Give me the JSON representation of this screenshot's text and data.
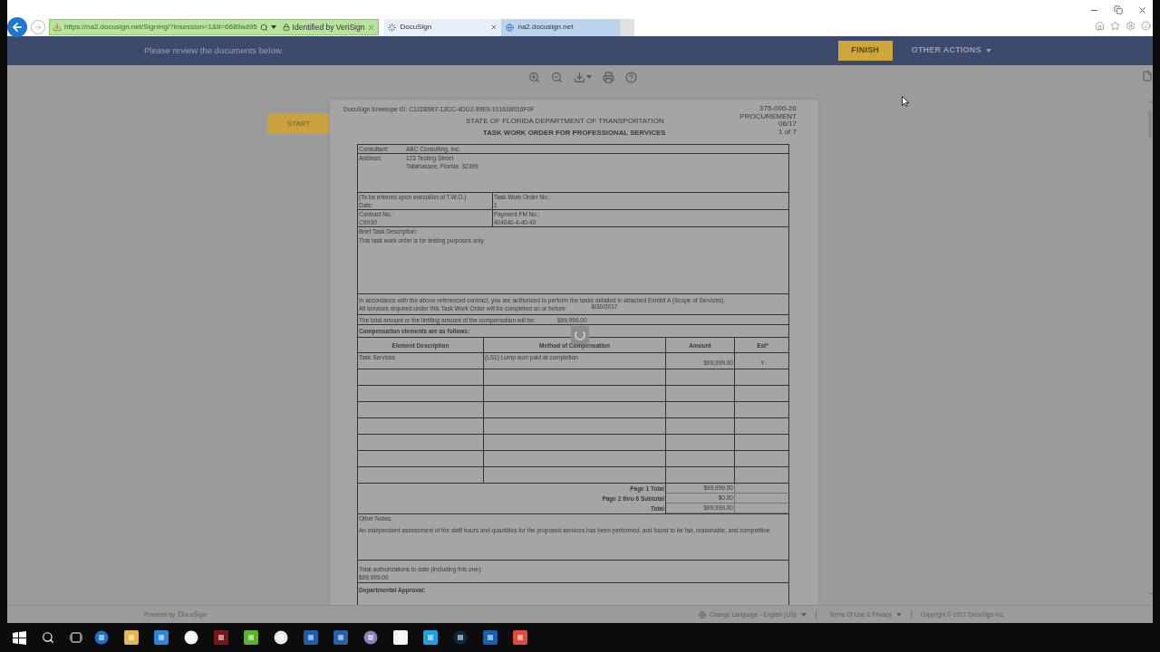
{
  "browser": {
    "address": "https://na2.docusign.net/Signing/?insession=1&ti=6689ad95",
    "identity": "Identified by VeriSign",
    "tabs": [
      {
        "title": "DocuSign",
        "selected": true,
        "kind": "loading"
      },
      {
        "title": "na2.docusign.net",
        "selected": false,
        "kind": "site"
      }
    ]
  },
  "header": {
    "message": "Please review the documents below.",
    "finish": "FINISH",
    "other_actions": "OTHER ACTIONS"
  },
  "start_tag": "START",
  "document": {
    "envelope_id": "DocuSign Envelope ID: C11D8987-13CC-4DD2-99E9-10161B016F0F",
    "agency": "STATE OF FLORIDA DEPARTMENT OF TRANSPORTATION",
    "title": "TASK WORK ORDER FOR PROFESSIONAL SERVICES",
    "form_info": [
      "375-000-26",
      "PROCUREMENT",
      "06/17",
      "1 of 7"
    ],
    "consultant": {
      "label": "Consultant:",
      "value": "ABC Consulting, Inc."
    },
    "address": {
      "label": "Address:",
      "lines": [
        "123 Testing Street",
        "Tallahassee, Florida  32399"
      ]
    },
    "info_rows": [
      [
        [
          "(To be entered upon execution of T.W.O.)",
          "Date:"
        ],
        [
          "Task Work Order No.:",
          "1"
        ]
      ],
      [
        [
          "Contract No.:",
          "C9X00"
        ],
        [
          "Payment FM No.:",
          "404040-4-40-40"
        ]
      ]
    ],
    "brief": {
      "label": "Brief Task Description:",
      "text": "This task work order is for testing purposes only."
    },
    "authorization": {
      "text": "In accordance with the above referenced contract, you are authorized to perform the tasks detailed in attached Exhibit A (Scope of Services).",
      "completion": "All services required under this Task Work Order will be completed on or before:",
      "date": "8/30/2017"
    },
    "limit": {
      "label": "The total amount or the limiting amount of the compensation will be:",
      "value": "$99,999.00"
    },
    "compensation": {
      "title": "Compensation elements are as follows:",
      "columns": [
        "Element Description",
        "Method of Compensation",
        "Amount",
        "Est*"
      ],
      "rows": [
        [
          "Task Services",
          "(LS1) Lump sum paid at completion",
          "$99,999.00",
          "Y"
        ]
      ],
      "totals": [
        {
          "label": "Page 1 Total",
          "value": "$99,999.00"
        },
        {
          "label": "Page 2 thru 6 Subtotal",
          "value": "$0.00"
        },
        {
          "label": "Total",
          "value": "$99,999.00"
        }
      ]
    },
    "other_notes": {
      "label": "Other Notes:",
      "text": "An independent assessment of the staff hours and quantities for the proposed services has been performed, and found to be fair, reasonable, and competitive."
    },
    "total_auth": {
      "label": "Total authorizations to date (including this one):",
      "value": "$99,999.00"
    },
    "approval": {
      "label": "Departmental Approval:"
    }
  },
  "footer": {
    "powered_by": "Powered by",
    "brand": "DocuSign",
    "language": "Change Language - English (US)",
    "terms": "Terms Of Use & Privacy",
    "copyright": "Copyright © 2017 DocuSign Inc."
  }
}
